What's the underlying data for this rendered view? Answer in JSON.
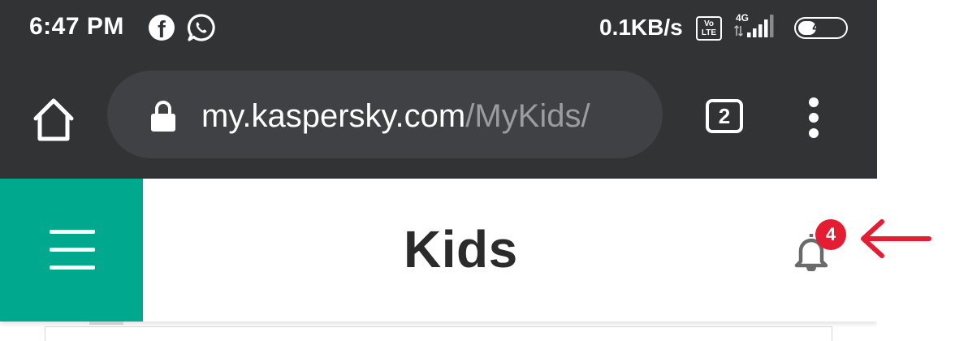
{
  "status_bar": {
    "time": "6:47 PM",
    "net_speed": "0.1KB/s",
    "volte_top": "Vo",
    "volte_bottom": "LTE",
    "network": "4G",
    "battery": "40",
    "battery_level": 0.4,
    "icons": [
      "facebook-icon",
      "whatsapp-icon",
      "volte-icon",
      "signal-icon",
      "battery-icon"
    ]
  },
  "browser": {
    "url_domain": "my.kaspersky.com",
    "url_path": "/MyKids/",
    "tab_count": "2",
    "icons": [
      "home-icon",
      "lock-icon",
      "tabs-icon",
      "overflow-menu-icon"
    ]
  },
  "app": {
    "title": "Kids",
    "notification_count": "4",
    "icons": [
      "hamburger-menu-icon",
      "bell-icon"
    ],
    "colors": {
      "accent": "#00a88e",
      "badge": "#e51d33",
      "annotation_arrow": "#e51d33"
    }
  }
}
